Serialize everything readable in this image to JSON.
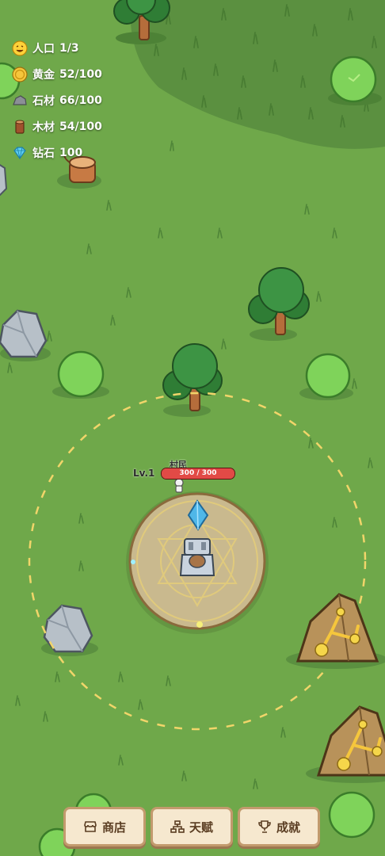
{
  "resources": [
    {
      "icon": "smile-face-icon",
      "label": "人口",
      "value": "1/3"
    },
    {
      "icon": "gold-coin-icon",
      "label": "黄金",
      "value": "52/100"
    },
    {
      "icon": "stone-icon",
      "label": "石材",
      "value": "66/100"
    },
    {
      "icon": "wood-log-icon",
      "label": "木材",
      "value": "54/100"
    },
    {
      "icon": "diamond-icon",
      "label": "钻石",
      "value": "100"
    }
  ],
  "villager": {
    "name": "村民",
    "level": "Lv.1",
    "hp_text": "300 / 300",
    "hp_fraction": 1.0
  },
  "buttons": {
    "shop": "商店",
    "talent": "天赋",
    "achievement": "成就"
  },
  "colors": {
    "grass": "#6fa84a",
    "dark_grass": "#5b9040",
    "button_bg": "#f6e8cf",
    "hp_red": "#e24a46"
  }
}
